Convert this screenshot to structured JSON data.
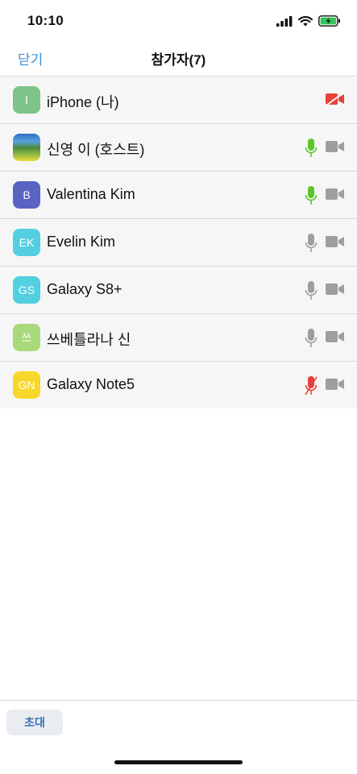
{
  "status": {
    "time": "10:10"
  },
  "nav": {
    "close_label": "닫기",
    "title": "참가자(7)"
  },
  "participants": [
    {
      "initials": "I",
      "name": "iPhone (나)",
      "avatar_color": "#7cc48a",
      "mic": "none",
      "video": "off"
    },
    {
      "initials": "",
      "name": "신영 이 (호스트)",
      "avatar_color": "photo",
      "mic": "active",
      "video": "on"
    },
    {
      "initials": "B",
      "name": "Valentina Kim",
      "avatar_color": "#5a63c2",
      "mic": "active",
      "video": "on"
    },
    {
      "initials": "EK",
      "name": "Evelin Kim",
      "avatar_color": "#52cfe0",
      "mic": "idle",
      "video": "on"
    },
    {
      "initials": "GS",
      "name": "Galaxy S8+",
      "avatar_color": "#52cfe0",
      "mic": "idle",
      "video": "on"
    },
    {
      "initials": "쓰",
      "name": "쓰베틀라나 신",
      "avatar_color": "#a8d97a",
      "mic": "idle",
      "video": "on"
    },
    {
      "initials": "GN",
      "name": "Galaxy Note5",
      "avatar_color": "#f7d82a",
      "mic": "muted",
      "video": "on"
    }
  ],
  "bottom": {
    "invite_label": "초대"
  },
  "colors": {
    "accent": "#3b8fd9",
    "mic_active": "#5ec42e",
    "icon_idle": "#9e9e9e",
    "muted_red": "#e8413a"
  }
}
